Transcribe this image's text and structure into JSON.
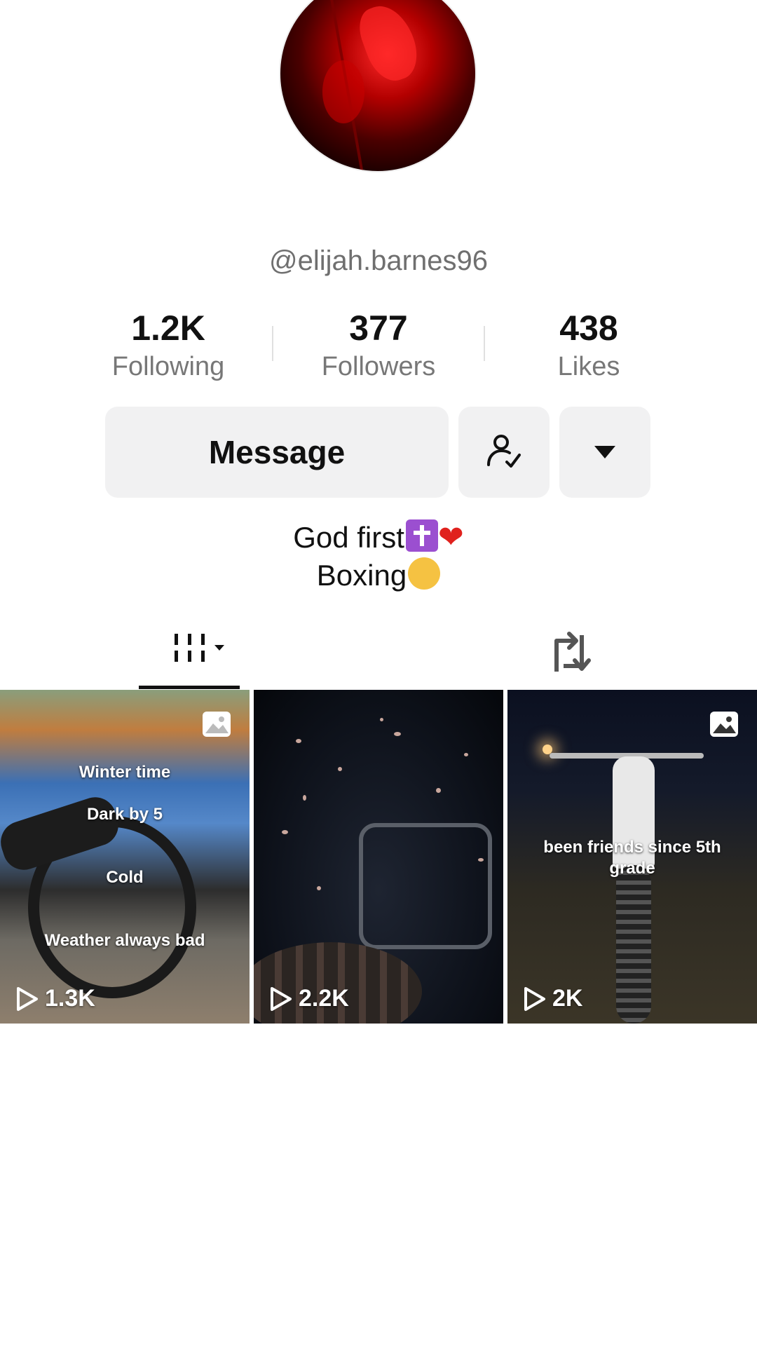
{
  "profile": {
    "username": "@elijah.barnes96",
    "bio_line1": "God first",
    "bio_line2": "Boxing"
  },
  "stats": {
    "following_count": "1.2K",
    "following_label": "Following",
    "followers_count": "377",
    "followers_label": "Followers",
    "likes_count": "438",
    "likes_label": "Likes"
  },
  "actions": {
    "message_label": "Message",
    "friends_icon": "person-check-icon",
    "more_icon": "caret-down-icon"
  },
  "tabs": {
    "videos_icon": "grid-columns-icon",
    "reposts_icon": "repost-icon"
  },
  "videos": [
    {
      "captions": [
        "Winter time",
        "Dark by 5",
        "Cold",
        "Weather always bad"
      ],
      "views": "1.3K",
      "badge": "photo-icon"
    },
    {
      "captions": [],
      "views": "2.2K"
    },
    {
      "captions": [
        "been friends since 5th grade"
      ],
      "views": "2K",
      "badge": "photo-icon"
    }
  ]
}
